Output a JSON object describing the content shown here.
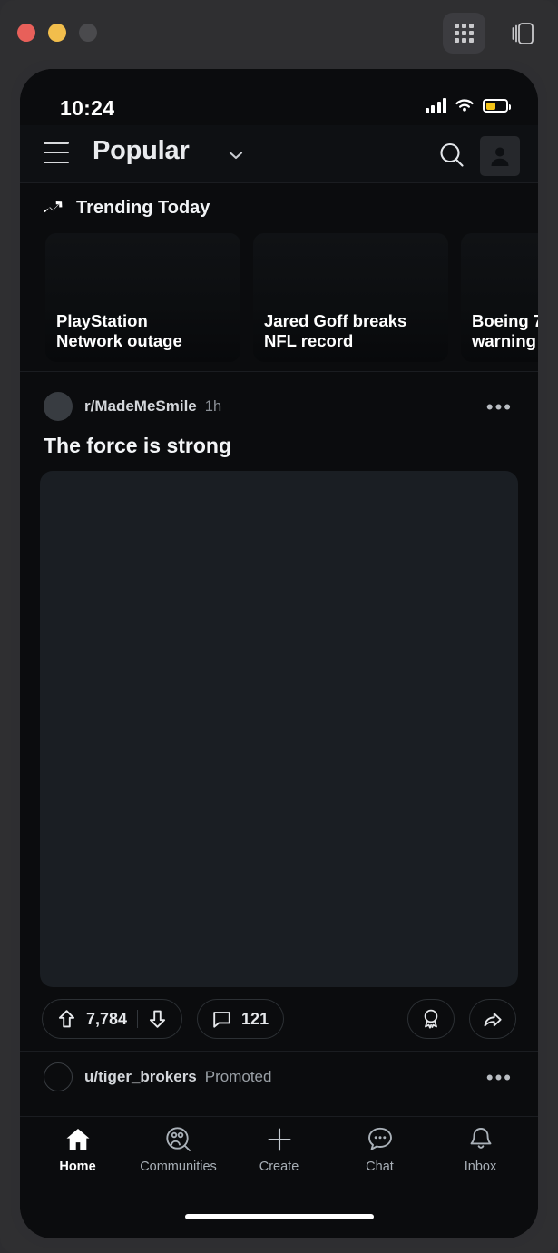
{
  "window": {
    "traffic_lights": [
      "close",
      "minimize",
      "maximize"
    ],
    "grid_icon": "app-grid-icon",
    "panel_icon": "stacked-cards-icon",
    "accent_yellow": "#f5c518",
    "bg": "#2f2f31"
  },
  "status_bar": {
    "time": "10:24",
    "cellular_icon": "signal-bars-icon",
    "wifi_icon": "wifi-icon",
    "battery_icon": "battery-icon",
    "battery_level_pct": 44,
    "battery_color": "#f5c518"
  },
  "appbar": {
    "menu_icon": "hamburger-menu-icon",
    "title": "Popular",
    "caret_icon": "chevron-down-icon",
    "search_icon": "search-icon",
    "avatar_icon": "user-avatar-icon"
  },
  "trending": {
    "icon": "trending-up-icon",
    "label": "Trending Today",
    "cards": [
      {
        "title": "PlayStation\nNetwork outage"
      },
      {
        "title": "Jared Goff breaks\nNFL record"
      },
      {
        "title": "Boeing 7\nwarning"
      }
    ]
  },
  "post": {
    "subreddit": "r/MadeMeSmile",
    "age": "1h",
    "more_icon": "overflow-menu-icon",
    "title": "The force is strong",
    "media_placeholder": "post-image",
    "actions": {
      "upvote_icon": "upvote-arrow-icon",
      "score": "7,784",
      "downvote_icon": "downvote-arrow-icon",
      "comment_icon": "comment-bubble-icon",
      "comment_count": "121",
      "award_icon": "award-medal-icon",
      "share_icon": "share-arrow-icon"
    }
  },
  "promoted": {
    "username": "u/tiger_brokers",
    "tag": "Promoted",
    "more_icon": "overflow-menu-icon"
  },
  "tabbar": {
    "items": [
      {
        "label": "Home",
        "icon": "home-icon",
        "active": true
      },
      {
        "label": "Communities",
        "icon": "communities-icon",
        "active": false
      },
      {
        "label": "Create",
        "icon": "plus-icon",
        "active": false
      },
      {
        "label": "Chat",
        "icon": "chat-bubble-icon",
        "active": false
      },
      {
        "label": "Inbox",
        "icon": "bell-icon",
        "active": false
      }
    ],
    "home_indicator": "home-indicator"
  }
}
